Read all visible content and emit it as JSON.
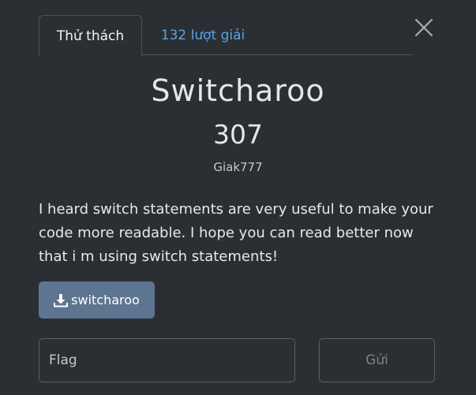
{
  "tabs": {
    "challenge": "Thử thách",
    "solves": "132 lượt giải"
  },
  "challenge": {
    "name": "Switcharoo",
    "points": "307",
    "author": "Giak777",
    "description": "I heard switch statements are very useful to make your code more readable. I hope you can read better now that i m using switch statements!"
  },
  "download": {
    "label": "switcharoo",
    "icon": "download-icon"
  },
  "flag": {
    "placeholder": "Flag",
    "value": ""
  },
  "submit": {
    "label": "Gửi"
  },
  "colors": {
    "background": "#2b2f33",
    "accent": "#5aa0e8",
    "button": "#5d7590"
  }
}
